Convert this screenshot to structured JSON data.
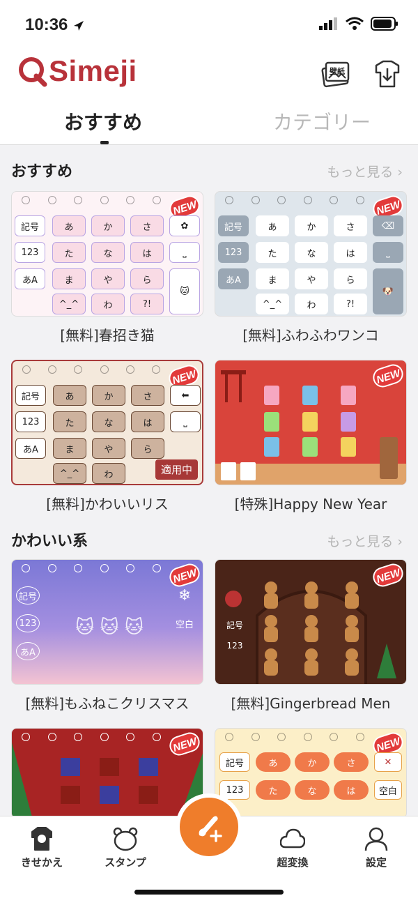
{
  "status": {
    "time": "10:36"
  },
  "app": {
    "logo": "Simeji",
    "brand_color": "#b8323a"
  },
  "header": {
    "wallpaper_badge": "壁紙"
  },
  "tabs": [
    {
      "label": "おすすめ",
      "active": true
    },
    {
      "label": "カテゴリー",
      "active": false
    }
  ],
  "sections": [
    {
      "title": "おすすめ",
      "more": "もっと見る",
      "cards": [
        {
          "caption": "[無料]春招き猫",
          "badge": "NEW",
          "keys": [
            "あ",
            "か",
            "さ",
            "た",
            "な",
            "は",
            "ま",
            "や",
            "ら",
            "^_^",
            "わ",
            "?!"
          ],
          "side_keys": [
            "記号",
            "123",
            "あA"
          ]
        },
        {
          "caption": "[無料]ふわふわワンコ",
          "badge": "NEW",
          "keys": [
            "あ",
            "か",
            "さ",
            "た",
            "な",
            "は",
            "ま",
            "や",
            "ら",
            "^_^",
            "わ",
            "?!"
          ],
          "side_keys": [
            "記号",
            "123",
            "あA"
          ]
        },
        {
          "caption": "[無料]かわいいリス",
          "badge": "NEW",
          "applied": "適用中",
          "keys": [
            "あ",
            "か",
            "さ",
            "た",
            "な",
            "は",
            "ま",
            "や",
            "ら",
            "^_^",
            "わ",
            "?!"
          ],
          "side_keys": [
            "記号",
            "123",
            "あA"
          ]
        },
        {
          "caption": "[特殊]Happy New Year",
          "badge": "NEW"
        }
      ]
    },
    {
      "title": "かわいい系",
      "more": "もっと見る",
      "cards": [
        {
          "caption": "[無料]もふねこクリスマス",
          "badge": "NEW",
          "side_keys": [
            "記号",
            "123",
            "あA"
          ],
          "extra": "空白"
        },
        {
          "caption": "[無料]Gingerbread Men",
          "badge": "NEW",
          "side_keys": [
            "記号",
            "123"
          ]
        },
        {
          "caption": "",
          "badge": "NEW"
        },
        {
          "caption": "",
          "badge": "NEW",
          "keys": [
            "あ",
            "か",
            "さ",
            "た",
            "な",
            "は"
          ],
          "side_keys": [
            "記号",
            "123"
          ],
          "extra": "空白"
        }
      ]
    }
  ],
  "tabbar": [
    {
      "label": "きせかえ",
      "icon": "tshirt-icon"
    },
    {
      "label": "スタンプ",
      "icon": "bear-icon"
    },
    {
      "label": "",
      "icon": "brush-plus-icon"
    },
    {
      "label": "超変換",
      "icon": "cloud-icon"
    },
    {
      "label": "設定",
      "icon": "person-icon"
    }
  ],
  "colors": {
    "accent": "#ef7d2b",
    "new_badge": "#e23a3a"
  }
}
